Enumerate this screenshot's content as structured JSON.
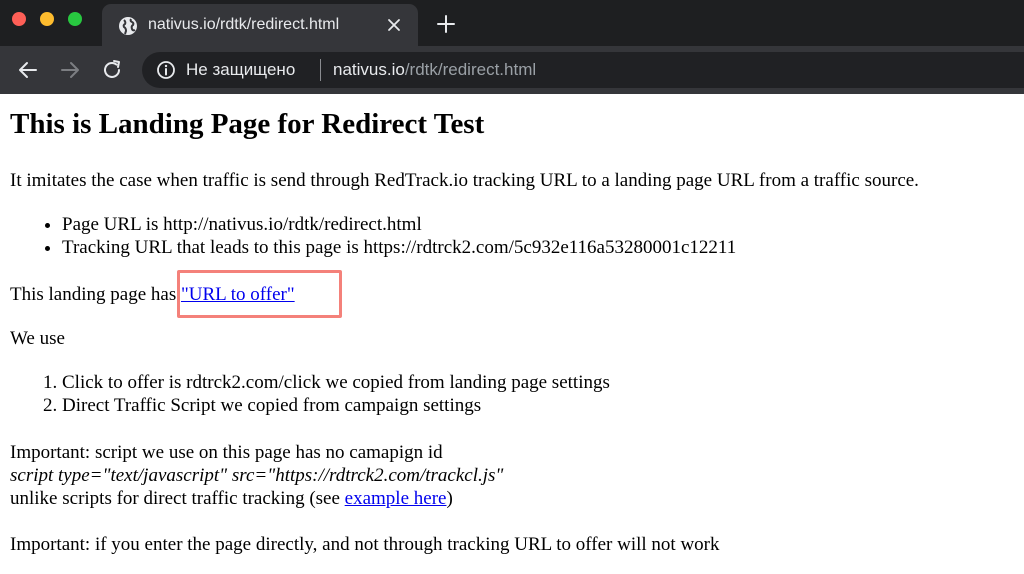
{
  "browser": {
    "tab": {
      "title": "nativus.io/rdtk/redirect.html",
      "favicon": "globe-icon"
    },
    "new_tab_icon": "plus-icon",
    "nav": {
      "back_icon": "back-arrow-icon",
      "forward_icon": "forward-arrow-icon",
      "reload_icon": "reload-icon"
    },
    "omnibox": {
      "security_icon": "info-icon",
      "security_label": "Не защищено",
      "url_host": "nativus.io",
      "url_path": "/rdtk/redirect.html"
    },
    "colors": {
      "tab_bar": "#1e1f21",
      "toolbar": "#35363a",
      "omnibox": "#202124",
      "highlight": "#f4817a",
      "link": "#0000ee"
    }
  },
  "page": {
    "heading": "This is Landing Page for Redirect Test",
    "intro": "It imitates the case when traffic is send through RedTrack.io tracking URL to a landing page URL from a traffic source.",
    "bullets": [
      "Page URL is http://nativus.io/rdtk/redirect.html",
      "Tracking URL that leads to this page is https://rdtrck2.com/5c932e116a53280001c12211"
    ],
    "offer_prefix": "This landing page has ",
    "offer_link": "\"URL to offer\"",
    "we_use": "We use",
    "steps": [
      "Click to offer is rdtrck2.com/click we copied from landing page settings",
      "Direct Traffic Script we copied from campaign settings"
    ],
    "important1": "Important: script we use on this page has no camapign id",
    "script_line": "script type=\"text/javascript\" src=\"https://rdtrck2.com/trackcl.js\"",
    "unlike_prefix": "unlike scripts for direct traffic tracking (see ",
    "example_link": "example here",
    "unlike_suffix": ")",
    "important2": "Important: if you enter the page directly, and not through tracking URL to offer will not work"
  }
}
